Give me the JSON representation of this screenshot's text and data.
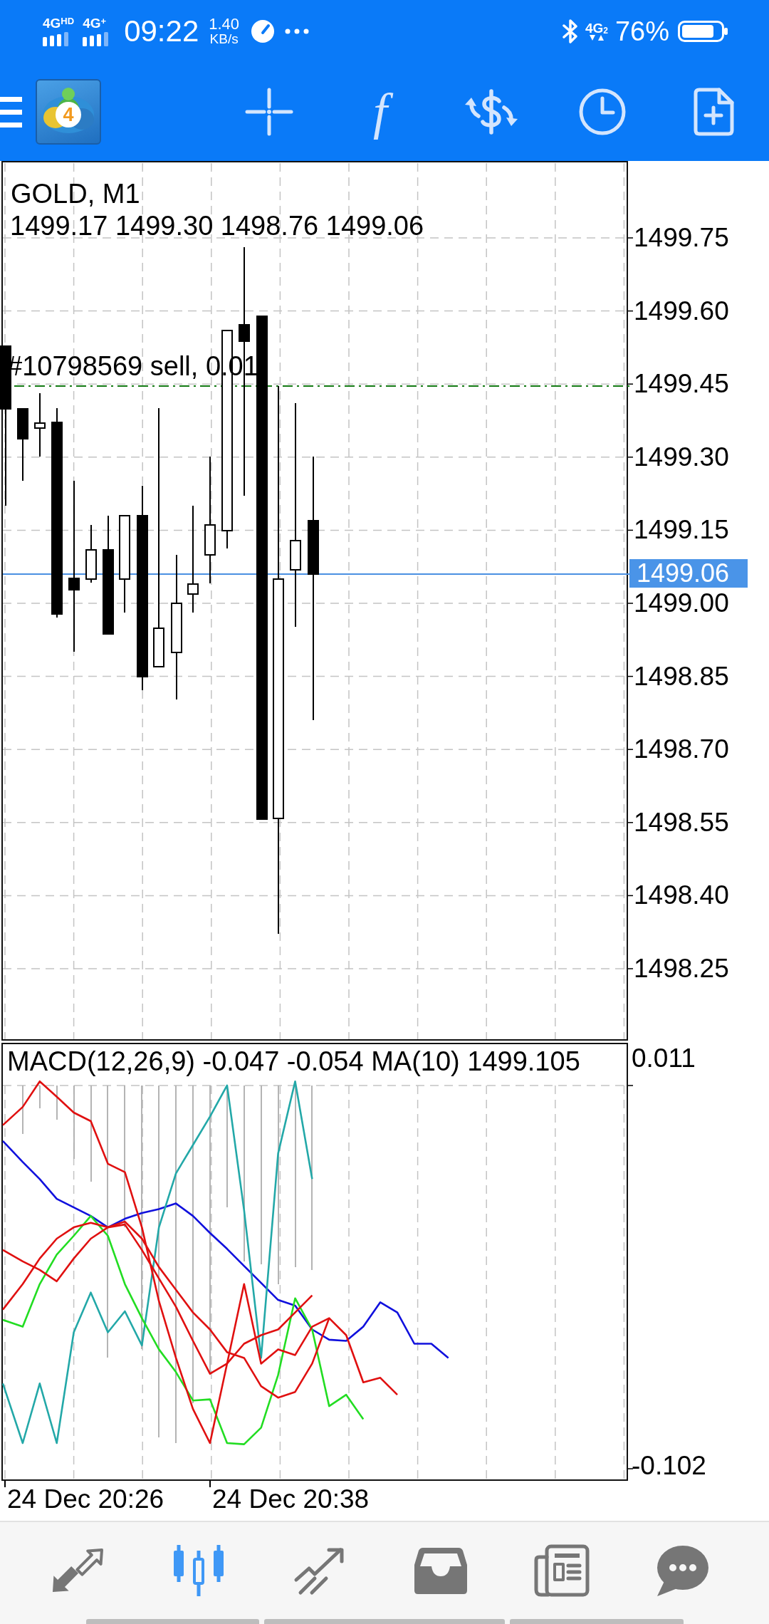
{
  "status_bar": {
    "networks": [
      {
        "label": "4G$^{HD}$"
      },
      {
        "label": "4G$^{+}$"
      }
    ],
    "time": "09:22",
    "speed_value": "1.40",
    "speed_unit": "KB/s",
    "network_right": "4G$_{2}$",
    "battery_percent": "76%"
  },
  "toolbar": {
    "logo_badge": "4",
    "tools": [
      {
        "kind": "crosshair"
      },
      {
        "kind": "function",
        "glyph": "f"
      },
      {
        "kind": "trade"
      },
      {
        "kind": "period"
      },
      {
        "kind": "new_order"
      }
    ]
  },
  "chart": {
    "symbol": "GOLD, M1",
    "ohlc": "1499.17 1499.30 1498.76 1499.06",
    "order_label": "#10798569 sell, 0.01",
    "price_axis": [
      "1499.75",
      "1499.60",
      "1499.45",
      "1499.30",
      "1499.15",
      "1499.00",
      "1498.85",
      "1498.70",
      "1498.55",
      "1498.40",
      "1498.25"
    ],
    "current_price": "1499.06"
  },
  "indicator": {
    "title": "MACD(12,26,9) -0.047 -0.054 MA(10) 1499.105",
    "axis": [
      "0.011",
      "-0.102"
    ]
  },
  "time_axis": [
    "24 Dec 20:26",
    "24 Dec 20:38"
  ],
  "bottom_nav": [
    {
      "kind": "quotes",
      "selected": false
    },
    {
      "kind": "chart",
      "selected": true
    },
    {
      "kind": "trade",
      "selected": false
    },
    {
      "kind": "history",
      "selected": false
    },
    {
      "kind": "news",
      "selected": false
    },
    {
      "kind": "messages",
      "selected": false
    }
  ]
}
